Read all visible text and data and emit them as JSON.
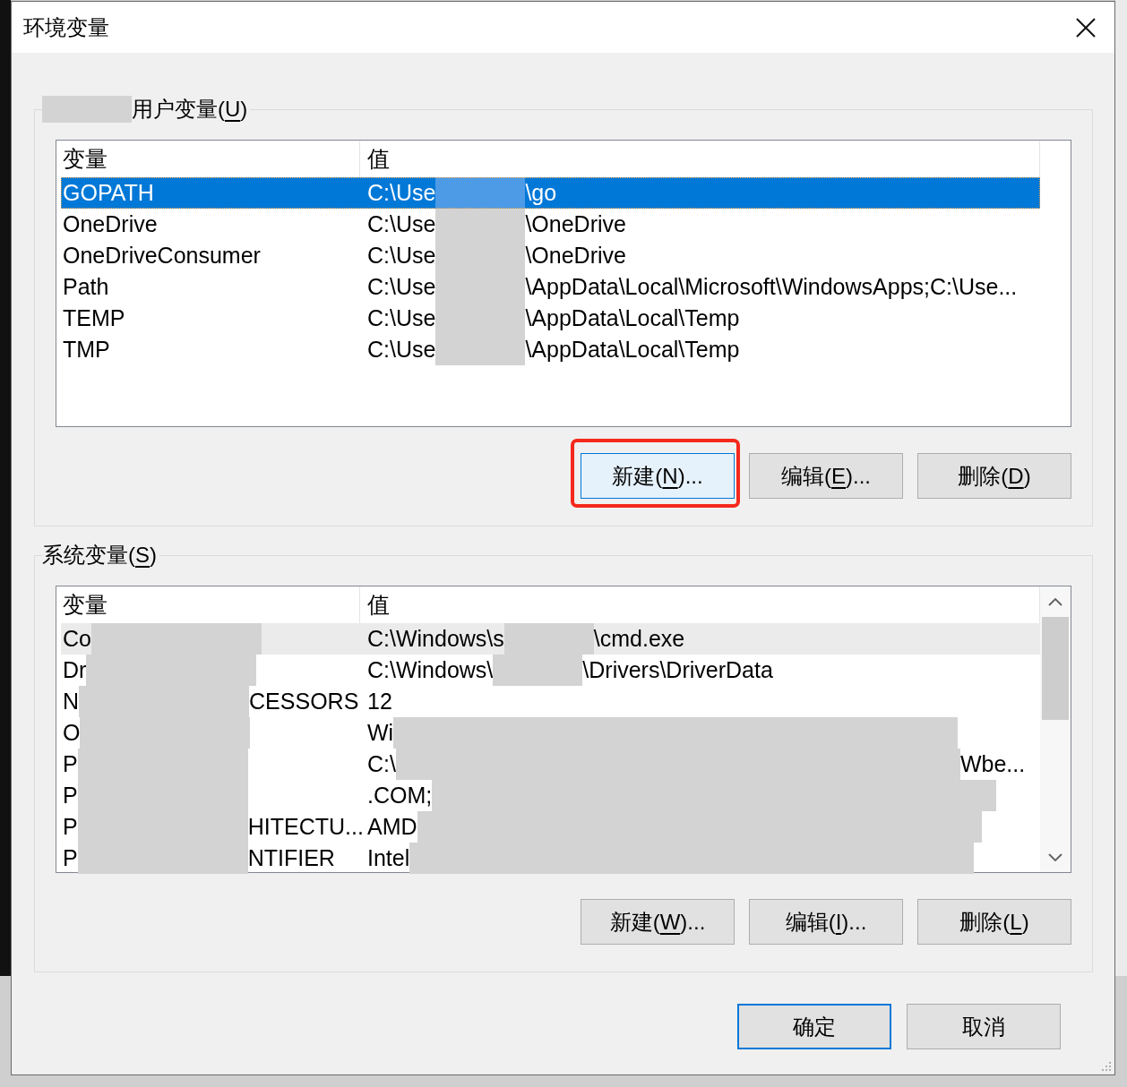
{
  "window": {
    "title": "环境变量"
  },
  "user_variables": {
    "group_label": {
      "kind": "masked_short",
      "label_start": "用户变量(",
      "mnemonic": "U",
      "label_end": ")"
    },
    "table": {
      "focused": true,
      "scrollbar": false,
      "columns": [
        "变量",
        "值"
      ],
      "rows": [
        {
          "selected": true,
          "name": {
            "kind": "plain",
            "text": "GOPATH"
          },
          "value": {
            "kind": "masked_short",
            "text": "C:\\Use",
            "text_end": "\\go"
          }
        },
        {
          "selected": false,
          "name": {
            "kind": "plain",
            "text": "OneDrive"
          },
          "value": {
            "kind": "masked_short",
            "text": "C:\\Use",
            "text_end": "\\OneDrive"
          }
        },
        {
          "selected": false,
          "name": {
            "kind": "plain",
            "text": "OneDriveConsumer"
          },
          "value": {
            "kind": "masked_short",
            "text": "C:\\Use",
            "text_end": "\\OneDrive"
          }
        },
        {
          "selected": false,
          "name": {
            "kind": "plain",
            "text": "Path"
          },
          "value": {
            "kind": "masked_short",
            "text": "C:\\Use",
            "text_end": "\\AppData\\Local\\Microsoft\\WindowsApps;C:\\Use..."
          }
        },
        {
          "selected": false,
          "name": {
            "kind": "plain",
            "text": "TEMP"
          },
          "value": {
            "kind": "masked_short",
            "text": "C:\\Use",
            "text_end": "\\AppData\\Local\\Temp"
          }
        },
        {
          "selected": false,
          "name": {
            "kind": "plain",
            "text": "TMP"
          },
          "value": {
            "kind": "masked_short",
            "text": "C:\\Use",
            "text_end": "\\AppData\\Local\\Temp"
          }
        }
      ]
    },
    "buttons": [
      {
        "label_start": "新建(",
        "mnemonic": "N",
        "label_end": ")...",
        "hovered": true,
        "highlighted": true
      },
      {
        "label_start": "编辑(",
        "mnemonic": "E",
        "label_end": ")...",
        "hovered": false,
        "highlighted": false
      },
      {
        "label_start": "删除(",
        "mnemonic": "D",
        "label_end": ")",
        "hovered": false,
        "highlighted": false
      }
    ]
  },
  "system_variables": {
    "group_label": {
      "kind": "plain",
      "label_start": "系统变量(",
      "mnemonic": "S",
      "label_end": ")"
    },
    "table": {
      "focused": false,
      "scrollbar": true,
      "columns": [
        "变量",
        "值"
      ],
      "rows": [
        {
          "selected": true,
          "name": {
            "kind": "masked_medium",
            "text": "Co"
          },
          "value": {
            "kind": "masked_short",
            "text": "C:\\Windows\\s",
            "text_end": "\\cmd.exe"
          }
        },
        {
          "selected": false,
          "name": {
            "kind": "masked_medium",
            "text": "Dr"
          },
          "value": {
            "kind": "masked_short",
            "text": "C:\\Windows\\",
            "text_end": "\\Drivers\\DriverData"
          }
        },
        {
          "selected": false,
          "name": {
            "kind": "masked_medium",
            "text": "N",
            "text_end": "CESSORS"
          },
          "value": {
            "kind": "plain",
            "text": "12"
          }
        },
        {
          "selected": false,
          "name": {
            "kind": "masked_medium",
            "text": "O"
          },
          "value": {
            "kind": "masked_long",
            "text": "Wi"
          }
        },
        {
          "selected": false,
          "name": {
            "kind": "masked_medium",
            "text": "P"
          },
          "value": {
            "kind": "masked_long",
            "text": "C:\\",
            "text_end": "Wbe..."
          }
        },
        {
          "selected": false,
          "name": {
            "kind": "masked_medium",
            "text": "P"
          },
          "value": {
            "kind": "masked_long",
            "text": ".COM;"
          }
        },
        {
          "selected": false,
          "name": {
            "kind": "masked_medium",
            "text": "P",
            "text_end": "HITECTU..."
          },
          "value": {
            "kind": "masked_long",
            "text": "AMD"
          }
        },
        {
          "selected": false,
          "name": {
            "kind": "masked_medium",
            "text": "P",
            "text_end": "NTIFIER"
          },
          "value": {
            "kind": "masked_long",
            "text": "Intel"
          }
        }
      ]
    },
    "buttons": [
      {
        "label_start": "新建(",
        "mnemonic": "W",
        "label_end": ")...",
        "hovered": false,
        "highlighted": false
      },
      {
        "label_start": "编辑(",
        "mnemonic": "I",
        "label_end": ")...",
        "hovered": false,
        "highlighted": false
      },
      {
        "label_start": "删除(",
        "mnemonic": "L",
        "label_end": ")",
        "hovered": false,
        "highlighted": false
      }
    ]
  },
  "dialog_buttons": [
    {
      "label": "确定",
      "default": true
    },
    {
      "label": "取消",
      "default": false
    }
  ]
}
